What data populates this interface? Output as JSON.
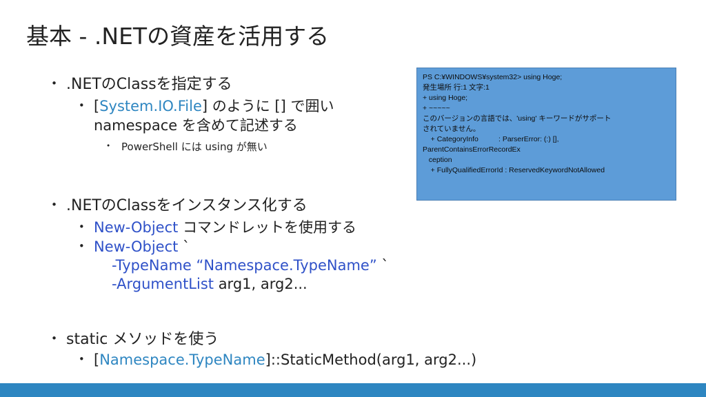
{
  "title": "基本 - .NETの資産を活用する",
  "bullet_glyph": "•",
  "items": {
    "b1": ".NETのClassを指定する",
    "b1_1_open": "[",
    "b1_1_class": "System.IO.File",
    "b1_1_close": "]",
    "b1_1_rest": " のように [] で囲い",
    "b1_1_line2": "namespace を含めて記述する",
    "b1_1_1": "PowerShell には using が無い",
    "b2": ".NETのClassをインスタンス化する",
    "b2_1_cmd": "New-Object",
    "b2_1_rest": " コマンドレットを使用する",
    "b2_2_cmd": "New-Object",
    "b2_2_tick": " `",
    "b2_2_line2_param": "-TypeName",
    "b2_2_line2_value": " “Namespace.TypeName”",
    "b2_2_line2_tick": " `",
    "b2_2_line3_param": "-ArgumentList",
    "b2_2_line3_value": " arg1, arg2...",
    "b3": "static メソッドを使う",
    "b3_1_open": "[",
    "b3_1_class": "Namespace.TypeName",
    "b3_1_rest": "]::StaticMethod(arg1, arg2...)"
  },
  "console": {
    "lines": [
      "PS C:¥WINDOWS¥system32> using Hoge;",
      "発生場所 行:1 文字:1",
      "+ using Hoge;",
      "+ ~~~~~",
      "このバージョンの言語では、'using' キーワードがサポート",
      "されていません。",
      "    + CategoryInfo          : ParserError: (:) [],",
      "ParentContainsErrorRecordEx",
      "   ception",
      "    + FullyQualifiedErrorId : ReservedKeywordNotAllowed"
    ]
  },
  "colors": {
    "command": "#2f51c8",
    "classname": "#2e86c1",
    "console_bg": "#5d9cd8",
    "footer_bar": "#2e86c1"
  }
}
